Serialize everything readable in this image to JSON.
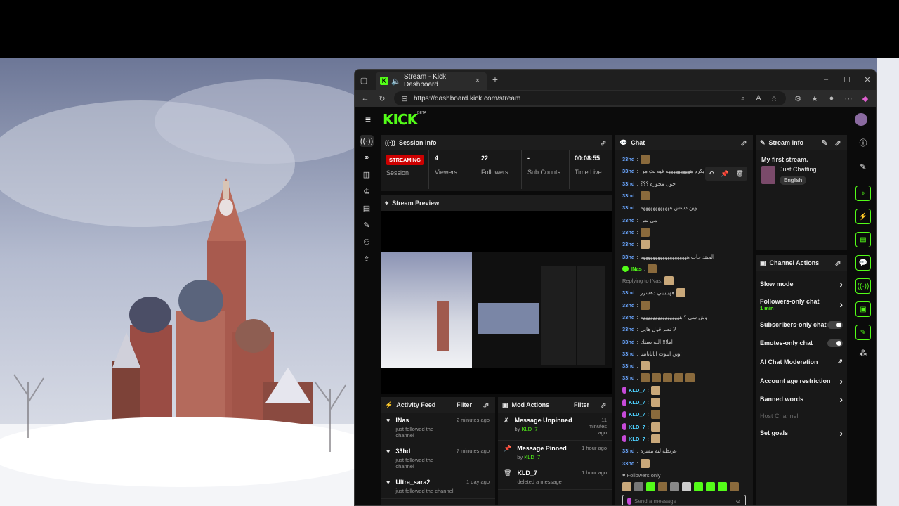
{
  "browser": {
    "tab_title": "Stream - Kick Dashboard",
    "url": "https://dashboard.kick.com/stream",
    "new_tab": "+",
    "close": "×"
  },
  "window_controls": {
    "minimize": "–",
    "maximize": "☐",
    "close": "✕"
  },
  "logo": {
    "text": "KICK",
    "beta": "BETA"
  },
  "session": {
    "title": "Session Info",
    "badge": "STREAMING",
    "badge_label": "Session",
    "stats": [
      {
        "value": "4",
        "label": "Viewers"
      },
      {
        "value": "22",
        "label": "Followers"
      },
      {
        "value": "-",
        "label": "Sub Counts"
      },
      {
        "value": "00:08:55",
        "label": "Time Live"
      }
    ]
  },
  "preview": {
    "title": "Stream Preview"
  },
  "activity": {
    "title": "Activity Feed",
    "filter": "Filter",
    "items": [
      {
        "name": "INas",
        "time": "2 minutes ago",
        "desc": "just followed the channel"
      },
      {
        "name": "33hd",
        "time": "7 minutes ago",
        "desc": "just followed the channel"
      },
      {
        "name": "Ultra_sara2",
        "time": "1 day ago",
        "desc": "just followed the channel"
      }
    ]
  },
  "mod": {
    "title": "Mod Actions",
    "filter": "Filter",
    "items": [
      {
        "title": "Message Unpinned",
        "by": "by",
        "user": "KLD_7",
        "time": "11 minutes ago"
      },
      {
        "title": "Message Pinned",
        "by": "by",
        "user": "KLD_7",
        "time": "1 hour ago"
      },
      {
        "title": "KLD_7",
        "desc": "deleted a message",
        "time": "1 hour ago"
      }
    ]
  },
  "chat": {
    "title": "Chat",
    "followers_only": "Followers only",
    "placeholder": "Send a message",
    "lines": [
      {
        "user": "33hd",
        "text": ""
      },
      {
        "user": "33hd",
        "text": "ههه اول بايت هاهس بكره ههههههههههه فيه بث مرا"
      },
      {
        "user": "33hd",
        "text": "حول محوره ؟؟؟"
      },
      {
        "user": "33hd",
        "text": ""
      },
      {
        "user": "33hd",
        "text": "وين دسس ههههههههههههه"
      },
      {
        "user": "33hd",
        "text": "مي نس"
      },
      {
        "user": "33hd",
        "text": ""
      },
      {
        "user": "33hd",
        "text": ""
      },
      {
        "user": "33hd",
        "text": "الميتد جات هههههههههههههههههههه"
      },
      {
        "user": "INas",
        "text": ""
      },
      {
        "user": "Replying to INas:",
        "text": ""
      },
      {
        "user": "33hd",
        "text": "ههيييييي دهسرر"
      },
      {
        "user": "33hd",
        "text": ""
      },
      {
        "user": "33hd",
        "text": "وش سي ؟ ههههههههههههههههه"
      },
      {
        "user": "33hd",
        "text": "لا نصر قول هايي"
      },
      {
        "user": "33hd",
        "text": "اها!!! الله يعينك"
      },
      {
        "user": "33hd",
        "text": "وين ابيوت ابابابابيبا!"
      },
      {
        "user": "33hd",
        "text": ""
      },
      {
        "user": "33hd",
        "text": ""
      },
      {
        "user": "KLD_7",
        "text": ""
      },
      {
        "user": "KLD_7",
        "text": ""
      },
      {
        "user": "KLD_7",
        "text": ""
      },
      {
        "user": "KLD_7",
        "text": ""
      },
      {
        "user": "KLD_7",
        "text": ""
      },
      {
        "user": "33hd",
        "text": "عربطه ليه مسرة"
      },
      {
        "user": "33hd",
        "text": ""
      }
    ]
  },
  "stream_info": {
    "title": "Stream info",
    "stream_title": "My first stream.",
    "category": "Just Chatting",
    "language": "English"
  },
  "channel_actions": {
    "title": "Channel Actions",
    "items": [
      {
        "label": "Slow mode",
        "type": "arrow"
      },
      {
        "label": "Followers-only chat",
        "sub": "1 min",
        "type": "arrow"
      },
      {
        "label": "Subscribers-only chat",
        "type": "toggle"
      },
      {
        "label": "Emotes-only chat",
        "type": "toggle"
      },
      {
        "label": "AI Chat Moderation",
        "type": "external"
      },
      {
        "label": "Account age restriction",
        "type": "arrow"
      },
      {
        "label": "Banned words",
        "type": "arrow"
      },
      {
        "label": "Host Channel",
        "type": "disabled"
      },
      {
        "label": "Set goals",
        "type": "arrow"
      }
    ]
  },
  "colors": {
    "accent": "#53fc18",
    "live": "#cc0000",
    "panel": "#181818"
  }
}
